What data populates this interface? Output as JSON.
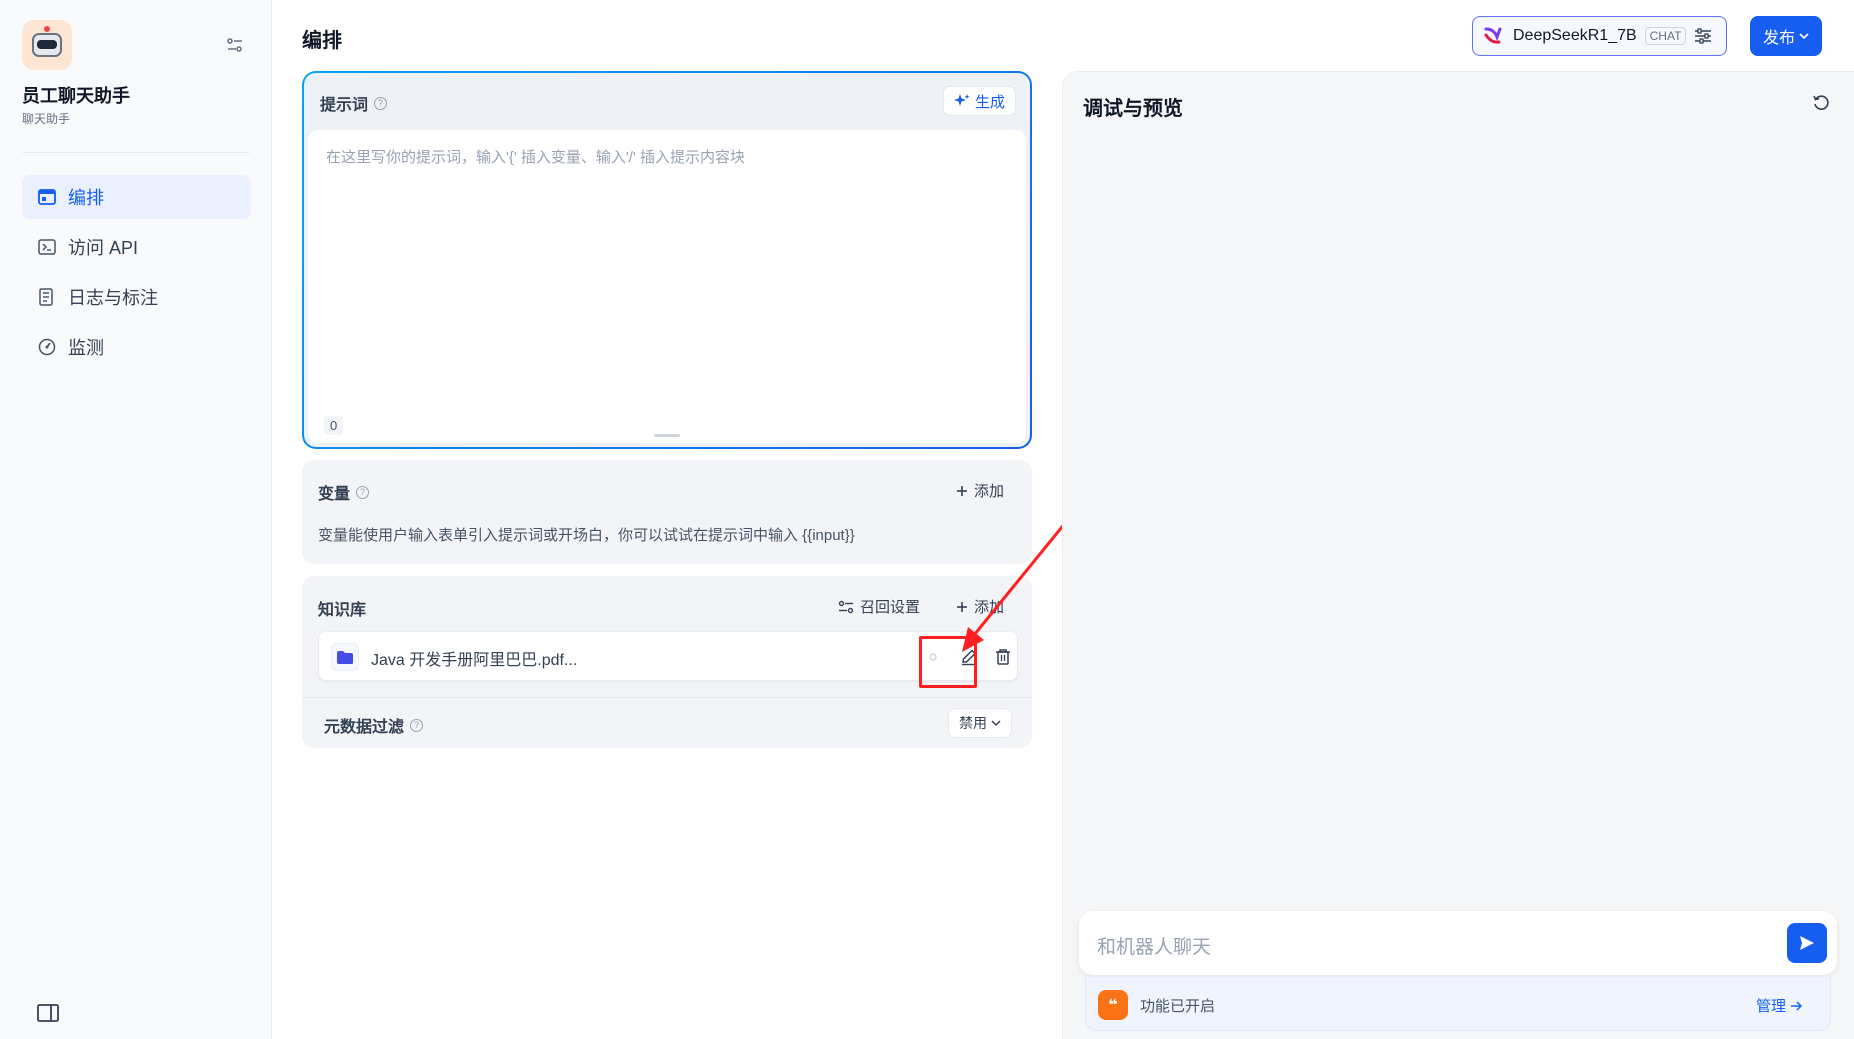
{
  "app": {
    "name": "员工聊天助手",
    "type": "聊天助手"
  },
  "sidebar": {
    "items": [
      {
        "label": "编排",
        "icon": "layout-icon",
        "active": true
      },
      {
        "label": "访问 API",
        "icon": "terminal-icon",
        "active": false
      },
      {
        "label": "日志与标注",
        "icon": "file-text-icon",
        "active": false
      },
      {
        "label": "监测",
        "icon": "dashboard-icon",
        "active": false
      }
    ]
  },
  "main": {
    "title": "编排",
    "prompt": {
      "title": "提示词",
      "generate_label": "生成",
      "placeholder": "在这里写你的提示词，输入'{' 插入变量、输入'/' 插入提示内容块",
      "char_count": "0"
    },
    "variables": {
      "title": "变量",
      "add_label": "添加",
      "description": "变量能使用户输入表单引入提示词或开场白，你可以试试在提示词中输入 {{input}}"
    },
    "knowledge": {
      "title": "知识库",
      "recall_label": "召回设置",
      "add_label": "添加",
      "items": [
        {
          "name": "Java 开发手册阿里巴巴.pdf..."
        }
      ],
      "metadata_filter": {
        "title": "元数据过滤",
        "value": "禁用"
      }
    }
  },
  "header": {
    "model_name": "DeepSeekR1_7B",
    "model_badge": "CHAT",
    "publish_label": "发布"
  },
  "preview": {
    "title": "调试与预览",
    "chat_placeholder": "和机器人聊天",
    "feature_text": "功能已开启",
    "manage_label": "管理"
  },
  "colors": {
    "accent": "#155eef",
    "annotation": "#ff1f1f",
    "feature_icon": "#f97316"
  }
}
